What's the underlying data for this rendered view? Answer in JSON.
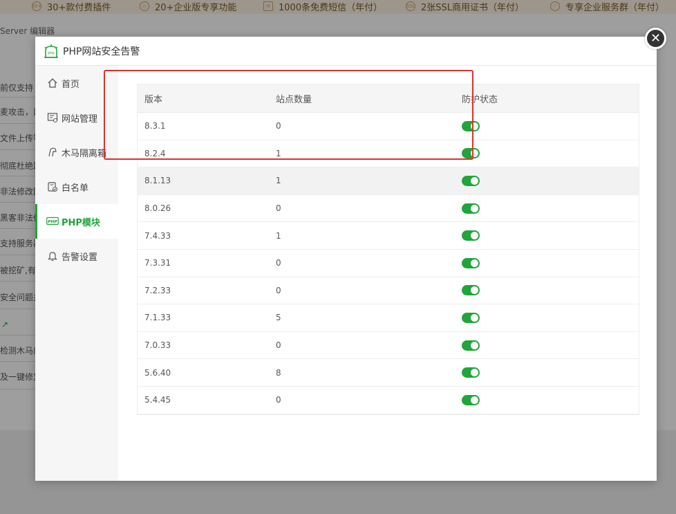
{
  "background": {
    "banner_items": [
      {
        "icon": "30+",
        "label": "30+款付费插件"
      },
      {
        "icon": "diamond",
        "label": "20+企业版专享功能"
      },
      {
        "icon": "mail",
        "label": "1000条免费短信（年付）"
      },
      {
        "icon": "SSL",
        "label": "2张SSL商用证书（年付）"
      },
      {
        "icon": "heart",
        "label": "专享企业服务群（年付）"
      }
    ],
    "editor_label": "Server 编辑器",
    "left_lines": [
      "前仅支持",
      "麦攻击，建",
      "文件上传等",
      "彻底杜绝跨",
      "非法修改网",
      "黑客非法修",
      "支持服务器",
      "被挖矿,有效",
      "安全问题并",
      "",
      "检测木马威",
      "及一键修复"
    ]
  },
  "modal": {
    "title": "PHP网站安全告警",
    "close_icon": "close-icon"
  },
  "sidebar": {
    "items": [
      {
        "label": "首页",
        "icon": "home-icon",
        "active": false
      },
      {
        "label": "网站管理",
        "icon": "site-manage-icon",
        "active": false
      },
      {
        "label": "木马隔离箱",
        "icon": "trojan-quarantine-icon",
        "active": false
      },
      {
        "label": "白名单",
        "icon": "whitelist-icon",
        "active": false
      },
      {
        "label": "PHP模块",
        "icon": "php-icon",
        "active": true
      },
      {
        "label": "告警设置",
        "icon": "bell-icon",
        "active": false
      }
    ]
  },
  "table": {
    "headers": [
      "版本",
      "站点数量",
      "防护状态"
    ],
    "rows": [
      {
        "version": "8.3.1",
        "count": "0",
        "enabled": true
      },
      {
        "version": "8.2.4",
        "count": "1",
        "enabled": true
      },
      {
        "version": "8.1.13",
        "count": "1",
        "enabled": true
      },
      {
        "version": "8.0.26",
        "count": "0",
        "enabled": true
      },
      {
        "version": "7.4.33",
        "count": "1",
        "enabled": true
      },
      {
        "version": "7.3.31",
        "count": "0",
        "enabled": true
      },
      {
        "version": "7.2.33",
        "count": "0",
        "enabled": true
      },
      {
        "version": "7.1.33",
        "count": "5",
        "enabled": true
      },
      {
        "version": "7.0.33",
        "count": "0",
        "enabled": true
      },
      {
        "version": "5.6.40",
        "count": "8",
        "enabled": true
      },
      {
        "version": "5.4.45",
        "count": "0",
        "enabled": true
      }
    ]
  },
  "colors": {
    "accent": "#20a53a",
    "highlight_box": "#e0302a"
  }
}
